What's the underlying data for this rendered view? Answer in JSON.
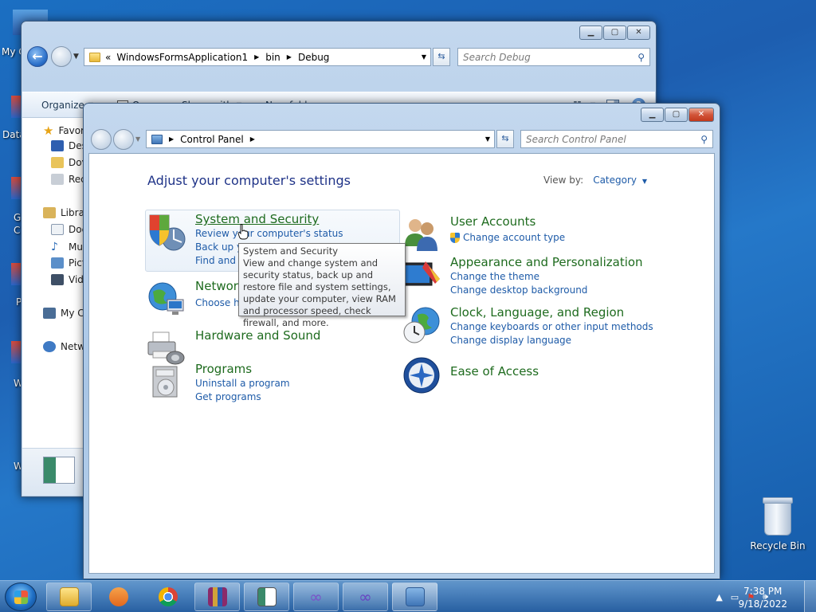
{
  "desktop": {
    "edge_labels": [
      "My C",
      "Data",
      "G",
      "C",
      "P",
      "W",
      "W"
    ],
    "recycle_bin_label": "Recycle Bin"
  },
  "explorer": {
    "address_prefix": "«",
    "breadcrumbs": [
      "WindowsFormsApplication1",
      "bin",
      "Debug"
    ],
    "search_placeholder": "Search Debug",
    "toolbar": {
      "organize": "Organize",
      "open": "Open",
      "share_with": "Share with",
      "new_folder": "New folder"
    },
    "nav": {
      "favorites": "Favor",
      "favorites_items": [
        "Des",
        "Dov",
        "Rec"
      ],
      "libraries": "Librar",
      "libraries_items": [
        "Doc",
        "Mus",
        "Pict",
        "Vide"
      ],
      "computer": "My C",
      "network": "Netw"
    }
  },
  "cpanel": {
    "breadcrumb": "Control Panel",
    "search_placeholder": "Search Control Panel",
    "heading": "Adjust your computer's settings",
    "view_by_label": "View by:",
    "view_by_value": "Category",
    "left": [
      {
        "title": "System and Security",
        "links": [
          "Review your computer's status",
          "Back up yo",
          "Find and f"
        ]
      },
      {
        "title": "Networ",
        "links": [
          "Choose ho"
        ]
      },
      {
        "title": "Hardware and Sound",
        "links": []
      },
      {
        "title": "Programs",
        "links": [
          "Uninstall a program",
          "Get programs"
        ]
      }
    ],
    "right": [
      {
        "title": "User Accounts",
        "links": [
          "Change account type"
        ]
      },
      {
        "title": "Appearance and Personalization",
        "links": [
          "Change the theme",
          "Change desktop background"
        ]
      },
      {
        "title": "Clock, Language, and Region",
        "links": [
          "Change keyboards or other input methods",
          "Change display language"
        ]
      },
      {
        "title": "Ease of Access",
        "links": []
      }
    ],
    "tooltip": {
      "title": "System and Security",
      "body": "View and change system and security status, back up and restore file and system settings, update your computer, view RAM and processor speed, check firewall, and more."
    }
  },
  "taskbar": {
    "time": "7:38 PM",
    "date": "9/18/2022",
    "pinned": [
      "explorer",
      "media-player",
      "chrome",
      "winrar",
      "app-window",
      "visual-studio",
      "visual-studio-2",
      "control-panel"
    ]
  },
  "colors": {
    "link": "#1e5ba8",
    "category_title": "#1e6b1e",
    "heading": "#1e3287"
  }
}
